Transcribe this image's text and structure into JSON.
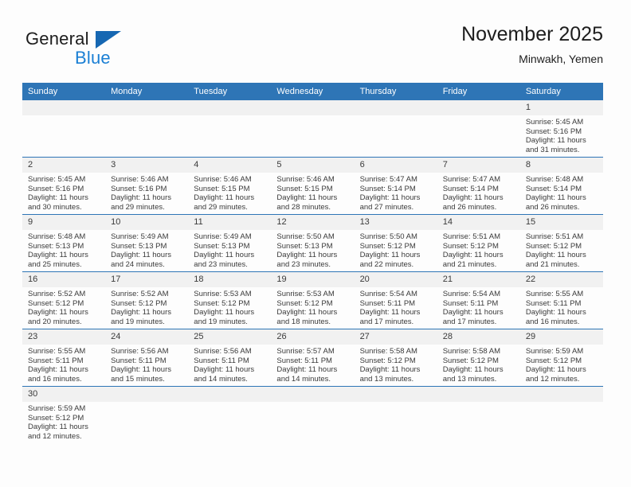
{
  "brand": {
    "name_part1": "General",
    "name_part2": "Blue",
    "color_dark": "#1d1d1d",
    "color_blue": "#1a7fd4",
    "triangle_color": "#1667b2"
  },
  "header": {
    "title": "November 2025",
    "subtitle": "Minwakh, Yemen"
  },
  "theme": {
    "header_bg": "#2e75b6",
    "daynum_bg": "#f1f1f1",
    "page_bg": "#fdfdfd",
    "text": "#3a3a3a"
  },
  "labels": {
    "sunrise_prefix": "Sunrise:",
    "sunset_prefix": "Sunset:",
    "daylight_prefix": "Daylight:"
  },
  "weekday_headers": [
    "Sunday",
    "Monday",
    "Tuesday",
    "Wednesday",
    "Thursday",
    "Friday",
    "Saturday"
  ],
  "weeks": [
    [
      {
        "day": "",
        "empty": true
      },
      {
        "day": "",
        "empty": true
      },
      {
        "day": "",
        "empty": true
      },
      {
        "day": "",
        "empty": true
      },
      {
        "day": "",
        "empty": true
      },
      {
        "day": "",
        "empty": true
      },
      {
        "day": "1",
        "sunrise": "Sunrise: 5:45 AM",
        "sunset": "Sunset: 5:16 PM",
        "daylight_line1": "Daylight: 11 hours",
        "daylight_line2": "and 31 minutes."
      }
    ],
    [
      {
        "day": "2",
        "sunrise": "Sunrise: 5:45 AM",
        "sunset": "Sunset: 5:16 PM",
        "daylight_line1": "Daylight: 11 hours",
        "daylight_line2": "and 30 minutes."
      },
      {
        "day": "3",
        "sunrise": "Sunrise: 5:46 AM",
        "sunset": "Sunset: 5:16 PM",
        "daylight_line1": "Daylight: 11 hours",
        "daylight_line2": "and 29 minutes."
      },
      {
        "day": "4",
        "sunrise": "Sunrise: 5:46 AM",
        "sunset": "Sunset: 5:15 PM",
        "daylight_line1": "Daylight: 11 hours",
        "daylight_line2": "and 29 minutes."
      },
      {
        "day": "5",
        "sunrise": "Sunrise: 5:46 AM",
        "sunset": "Sunset: 5:15 PM",
        "daylight_line1": "Daylight: 11 hours",
        "daylight_line2": "and 28 minutes."
      },
      {
        "day": "6",
        "sunrise": "Sunrise: 5:47 AM",
        "sunset": "Sunset: 5:14 PM",
        "daylight_line1": "Daylight: 11 hours",
        "daylight_line2": "and 27 minutes."
      },
      {
        "day": "7",
        "sunrise": "Sunrise: 5:47 AM",
        "sunset": "Sunset: 5:14 PM",
        "daylight_line1": "Daylight: 11 hours",
        "daylight_line2": "and 26 minutes."
      },
      {
        "day": "8",
        "sunrise": "Sunrise: 5:48 AM",
        "sunset": "Sunset: 5:14 PM",
        "daylight_line1": "Daylight: 11 hours",
        "daylight_line2": "and 26 minutes."
      }
    ],
    [
      {
        "day": "9",
        "sunrise": "Sunrise: 5:48 AM",
        "sunset": "Sunset: 5:13 PM",
        "daylight_line1": "Daylight: 11 hours",
        "daylight_line2": "and 25 minutes."
      },
      {
        "day": "10",
        "sunrise": "Sunrise: 5:49 AM",
        "sunset": "Sunset: 5:13 PM",
        "daylight_line1": "Daylight: 11 hours",
        "daylight_line2": "and 24 minutes."
      },
      {
        "day": "11",
        "sunrise": "Sunrise: 5:49 AM",
        "sunset": "Sunset: 5:13 PM",
        "daylight_line1": "Daylight: 11 hours",
        "daylight_line2": "and 23 minutes."
      },
      {
        "day": "12",
        "sunrise": "Sunrise: 5:50 AM",
        "sunset": "Sunset: 5:13 PM",
        "daylight_line1": "Daylight: 11 hours",
        "daylight_line2": "and 23 minutes."
      },
      {
        "day": "13",
        "sunrise": "Sunrise: 5:50 AM",
        "sunset": "Sunset: 5:12 PM",
        "daylight_line1": "Daylight: 11 hours",
        "daylight_line2": "and 22 minutes."
      },
      {
        "day": "14",
        "sunrise": "Sunrise: 5:51 AM",
        "sunset": "Sunset: 5:12 PM",
        "daylight_line1": "Daylight: 11 hours",
        "daylight_line2": "and 21 minutes."
      },
      {
        "day": "15",
        "sunrise": "Sunrise: 5:51 AM",
        "sunset": "Sunset: 5:12 PM",
        "daylight_line1": "Daylight: 11 hours",
        "daylight_line2": "and 21 minutes."
      }
    ],
    [
      {
        "day": "16",
        "sunrise": "Sunrise: 5:52 AM",
        "sunset": "Sunset: 5:12 PM",
        "daylight_line1": "Daylight: 11 hours",
        "daylight_line2": "and 20 minutes."
      },
      {
        "day": "17",
        "sunrise": "Sunrise: 5:52 AM",
        "sunset": "Sunset: 5:12 PM",
        "daylight_line1": "Daylight: 11 hours",
        "daylight_line2": "and 19 minutes."
      },
      {
        "day": "18",
        "sunrise": "Sunrise: 5:53 AM",
        "sunset": "Sunset: 5:12 PM",
        "daylight_line1": "Daylight: 11 hours",
        "daylight_line2": "and 19 minutes."
      },
      {
        "day": "19",
        "sunrise": "Sunrise: 5:53 AM",
        "sunset": "Sunset: 5:12 PM",
        "daylight_line1": "Daylight: 11 hours",
        "daylight_line2": "and 18 minutes."
      },
      {
        "day": "20",
        "sunrise": "Sunrise: 5:54 AM",
        "sunset": "Sunset: 5:11 PM",
        "daylight_line1": "Daylight: 11 hours",
        "daylight_line2": "and 17 minutes."
      },
      {
        "day": "21",
        "sunrise": "Sunrise: 5:54 AM",
        "sunset": "Sunset: 5:11 PM",
        "daylight_line1": "Daylight: 11 hours",
        "daylight_line2": "and 17 minutes."
      },
      {
        "day": "22",
        "sunrise": "Sunrise: 5:55 AM",
        "sunset": "Sunset: 5:11 PM",
        "daylight_line1": "Daylight: 11 hours",
        "daylight_line2": "and 16 minutes."
      }
    ],
    [
      {
        "day": "23",
        "sunrise": "Sunrise: 5:55 AM",
        "sunset": "Sunset: 5:11 PM",
        "daylight_line1": "Daylight: 11 hours",
        "daylight_line2": "and 16 minutes."
      },
      {
        "day": "24",
        "sunrise": "Sunrise: 5:56 AM",
        "sunset": "Sunset: 5:11 PM",
        "daylight_line1": "Daylight: 11 hours",
        "daylight_line2": "and 15 minutes."
      },
      {
        "day": "25",
        "sunrise": "Sunrise: 5:56 AM",
        "sunset": "Sunset: 5:11 PM",
        "daylight_line1": "Daylight: 11 hours",
        "daylight_line2": "and 14 minutes."
      },
      {
        "day": "26",
        "sunrise": "Sunrise: 5:57 AM",
        "sunset": "Sunset: 5:11 PM",
        "daylight_line1": "Daylight: 11 hours",
        "daylight_line2": "and 14 minutes."
      },
      {
        "day": "27",
        "sunrise": "Sunrise: 5:58 AM",
        "sunset": "Sunset: 5:12 PM",
        "daylight_line1": "Daylight: 11 hours",
        "daylight_line2": "and 13 minutes."
      },
      {
        "day": "28",
        "sunrise": "Sunrise: 5:58 AM",
        "sunset": "Sunset: 5:12 PM",
        "daylight_line1": "Daylight: 11 hours",
        "daylight_line2": "and 13 minutes."
      },
      {
        "day": "29",
        "sunrise": "Sunrise: 5:59 AM",
        "sunset": "Sunset: 5:12 PM",
        "daylight_line1": "Daylight: 11 hours",
        "daylight_line2": "and 12 minutes."
      }
    ],
    [
      {
        "day": "30",
        "sunrise": "Sunrise: 5:59 AM",
        "sunset": "Sunset: 5:12 PM",
        "daylight_line1": "Daylight: 11 hours",
        "daylight_line2": "and 12 minutes."
      },
      {
        "day": "",
        "empty": true
      },
      {
        "day": "",
        "empty": true
      },
      {
        "day": "",
        "empty": true
      },
      {
        "day": "",
        "empty": true
      },
      {
        "day": "",
        "empty": true
      },
      {
        "day": "",
        "empty": true
      }
    ]
  ]
}
